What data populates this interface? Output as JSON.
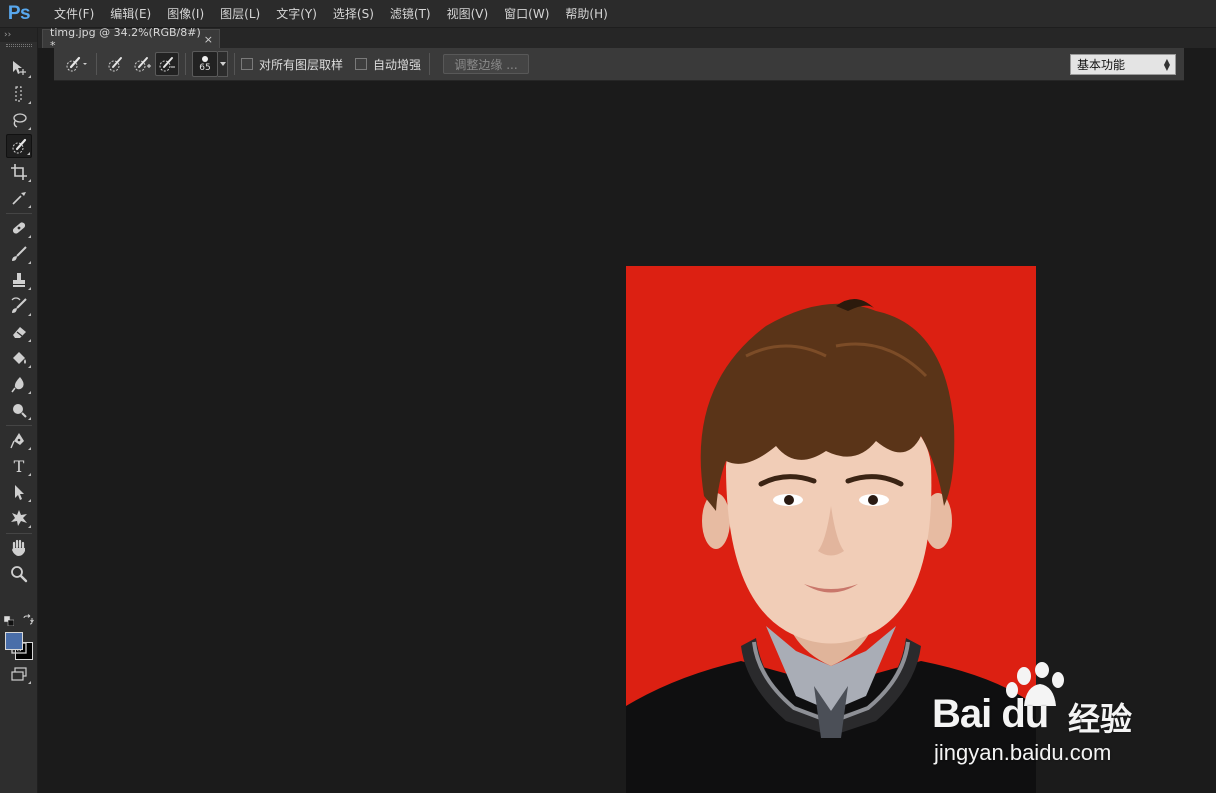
{
  "app": {
    "logo": "Ps",
    "menu": [
      "文件(F)",
      "编辑(E)",
      "图像(I)",
      "图层(L)",
      "文字(Y)",
      "选择(S)",
      "滤镜(T)",
      "视图(V)",
      "窗口(W)",
      "帮助(H)"
    ]
  },
  "toolbar": {
    "collapse_glyph": "››",
    "tools": [
      "move-tool",
      "marquee-tool",
      "lasso-tool",
      "quick-selection-tool",
      "crop-tool",
      "eyedropper-tool",
      "healing-brush-tool",
      "brush-tool",
      "clone-stamp-tool",
      "history-brush-tool",
      "eraser-tool",
      "paint-bucket-tool",
      "blur-tool",
      "dodge-tool",
      "pen-tool",
      "type-tool",
      "path-selection-tool",
      "custom-shape-tool",
      "hand-tool",
      "zoom-tool"
    ],
    "active_tool": "quick-selection-tool",
    "type_tool_glyph": "T",
    "foreground_color": "#4a6ea9",
    "background_color": "#000000"
  },
  "document": {
    "tab_label": "timg.jpg @ 34.2%(RGB/8#) *",
    "close_glyph": "×"
  },
  "options": {
    "brush_size": "65",
    "sample_all_layers_label": "对所有图层取样",
    "sample_all_layers_checked": false,
    "auto_enhance_label": "自动增强",
    "auto_enhance_checked": false,
    "refine_edge_label": "调整边缘 ...",
    "workspace": "基本功能"
  },
  "canvas": {
    "photo_background": "#dc2012"
  },
  "watermark": {
    "brand": "Bai du",
    "brand_cn": "经验",
    "url": "jingyan.baidu.com"
  }
}
